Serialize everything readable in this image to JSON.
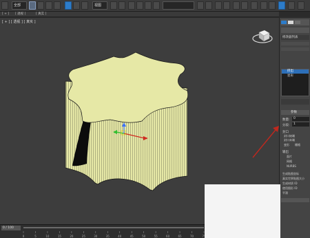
{
  "toolbar": {
    "mode_dropdown": "全部",
    "view_dropdown": "视图"
  },
  "menubar": {
    "items": [
      "[ + ]",
      "[ 透视 ]",
      "[ 真实 ]"
    ]
  },
  "viewport": {
    "label": "[ + ] [ 透视 ] [ 真实 ]"
  },
  "panel": {
    "modifier_list_label": "修改器列表",
    "stack_items": [
      "挤出",
      "星形"
    ],
    "params_title": "参数",
    "amount_label": "数量:",
    "amount_value": "0",
    "segments_label": "分段:",
    "segments_value": "1",
    "capping_label": "封口",
    "cap_start": "封口始端",
    "cap_end": "封口末端",
    "morph": "变形",
    "grid": "栅格",
    "output_label": "输出",
    "output_patch": "面片",
    "output_mesh": "网格",
    "output_nurbs": "NURBS",
    "gen_mapping": "生成贴图坐标",
    "real_world": "真实世界贴图大小",
    "gen_mat_ids": "生成材质 ID",
    "use_shape_ids": "使用图形 ID",
    "smooth": "平滑"
  },
  "timeline": {
    "frame_counter": "0 / 100",
    "ticks": [
      "0",
      "5",
      "10",
      "15",
      "20",
      "25",
      "30",
      "35",
      "40",
      "45",
      "50",
      "55",
      "60",
      "65",
      "70",
      "75"
    ]
  },
  "colors": {
    "object_fill": "#e6e8a6",
    "object_edge": "#1a1a1a",
    "viewport_bg": "#3d3d3d",
    "highlight_red": "#c0281e",
    "accent_blue": "#2d7cc9"
  }
}
